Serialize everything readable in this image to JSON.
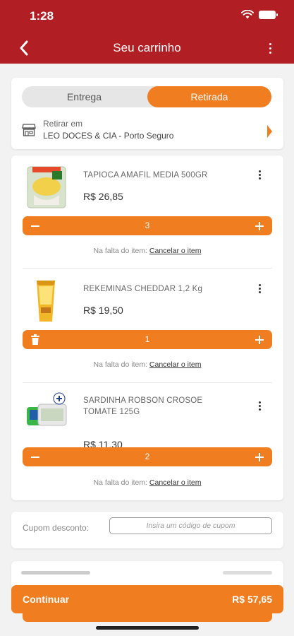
{
  "status_bar": {
    "time": "1:28"
  },
  "header": {
    "title": "Seu carrinho"
  },
  "delivery_toggle": {
    "options": [
      "Entrega",
      "Retirada"
    ],
    "selected": "Retirada"
  },
  "pickup": {
    "label": "Retirar em",
    "store": "LEO DOCES & CIA - Porto Seguro"
  },
  "items": [
    {
      "name": "TAPIOCA AMAFIL MEDIA  500GR",
      "price": "R$ 26,85",
      "quantity": "3",
      "absent_text": "Na falta do item:",
      "absent_action": "Cancelar o item"
    },
    {
      "name": "REKEMINAS CHEDDAR 1,2 Kg",
      "price": "R$ 19,50",
      "quantity": "1",
      "absent_text": "Na falta do item:",
      "absent_action": "Cancelar o item"
    },
    {
      "name": "SARDINHA  ROBSON CROSOE TOMATE 125G",
      "price": "R$ 11,30",
      "quantity": "2",
      "absent_text": "Na falta do item:",
      "absent_action": "Cancelar o item"
    }
  ],
  "coupon": {
    "label": "Cupom desconto:",
    "placeholder": "Insira um código de cupom"
  },
  "footer": {
    "continue_label": "Continuar",
    "total": "R$ 57,65"
  },
  "colors": {
    "header": "#b11f24",
    "accent": "#f07d1f"
  },
  "icons": {
    "back": "chevron-left-icon",
    "menu": "more-vertical-icon",
    "store": "store-icon",
    "minus": "minus-icon",
    "plus": "plus-icon",
    "trash": "trash-icon",
    "arrow": "chevron-right-icon"
  }
}
